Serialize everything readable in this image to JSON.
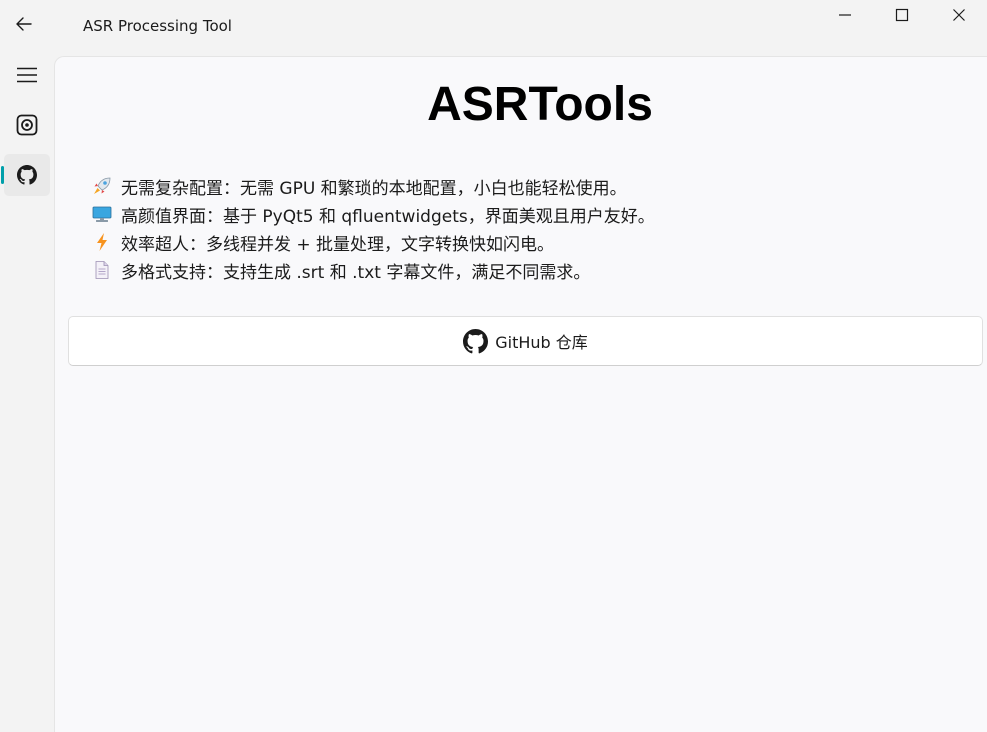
{
  "window": {
    "title": "ASR Processing Tool"
  },
  "nav": {
    "items": [
      {
        "icon": "menu-icon"
      },
      {
        "icon": "record-icon"
      },
      {
        "icon": "github-icon",
        "selected": true
      }
    ],
    "accent_color": "#009faa"
  },
  "main": {
    "title": "ASRTools",
    "features": [
      {
        "icon": "rocket-icon",
        "text": "无需复杂配置：无需 GPU 和繁琐的本地配置，小白也能轻松使用。"
      },
      {
        "icon": "computer-icon",
        "text": "高颜值界面：基于 PyQt5 和 qfluentwidgets，界面美观且用户友好。"
      },
      {
        "icon": "lightning-icon",
        "text": "效率超人：多线程并发 + 批量处理，文字转换快如闪电。"
      },
      {
        "icon": "document-icon",
        "text": "多格式支持：支持生成 .srt 和 .txt 字幕文件，满足不同需求。"
      }
    ],
    "github_button": {
      "icon": "github-icon",
      "label": "GitHub 仓库"
    }
  }
}
